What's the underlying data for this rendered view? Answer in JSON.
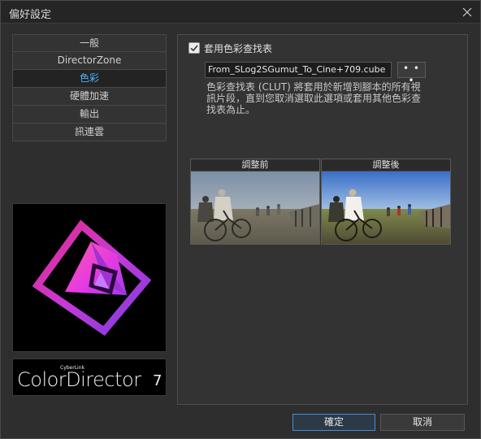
{
  "window": {
    "title": "偏好設定"
  },
  "nav": {
    "items": [
      {
        "label": "一般",
        "active": false
      },
      {
        "label": "DirectorZone",
        "active": false
      },
      {
        "label": "色彩",
        "active": true
      },
      {
        "label": "硬體加速",
        "active": false
      },
      {
        "label": "輸出",
        "active": false
      },
      {
        "label": "訊連雲",
        "active": false
      }
    ]
  },
  "brand": {
    "company": "CyberLink",
    "product": "ColorDirector",
    "version": "7"
  },
  "color_settings": {
    "apply_lut_label": "套用色彩查找表",
    "apply_lut_checked": true,
    "lut_file": "From_SLog2SGumut_To_Cine+709.cube",
    "browse_label": "• • •",
    "description": "色彩查找表 (CLUT) 將套用於新增到腳本的所有視訊片段，直到您取消選取此選項或套用其他色彩查找表為止。",
    "before_label": "調整前",
    "after_label": "調整後"
  },
  "footer": {
    "ok_label": "確定",
    "cancel_label": "取消"
  },
  "colors": {
    "active_nav": "#4ab4ff",
    "primary_border": "#3f8fd8",
    "logo_magenta": "#e040e0",
    "logo_purple": "#8a3bd8"
  }
}
